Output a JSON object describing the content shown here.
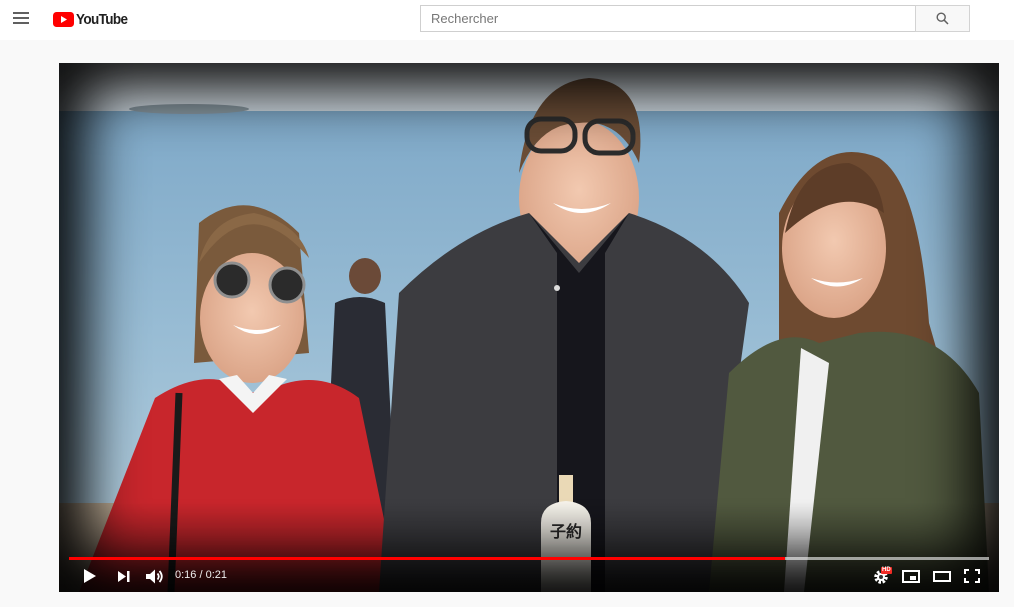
{
  "masthead": {
    "menu_icon": "hamburger-menu-icon",
    "logo_text": "YouTube",
    "logo_color": "#ff0000"
  },
  "search": {
    "placeholder": "Rechercher",
    "value": "",
    "button_icon": "search-icon"
  },
  "player": {
    "current_time": "0:16",
    "duration": "0:21",
    "time_display": "0:16 / 0:21",
    "played_fraction": 0.778,
    "loaded_fraction": 1.0,
    "progress_color": "#ff0000",
    "hd_badge": "HD",
    "controls": {
      "play_icon": "play-icon",
      "next_icon": "skip-next-icon",
      "volume_icon": "volume-icon",
      "settings_icon": "gear-icon",
      "miniplayer_icon": "miniplayer-icon",
      "theater_icon": "theater-mode-icon",
      "fullscreen_icon": "fullscreen-icon"
    },
    "video_overlay_text": "子約"
  }
}
